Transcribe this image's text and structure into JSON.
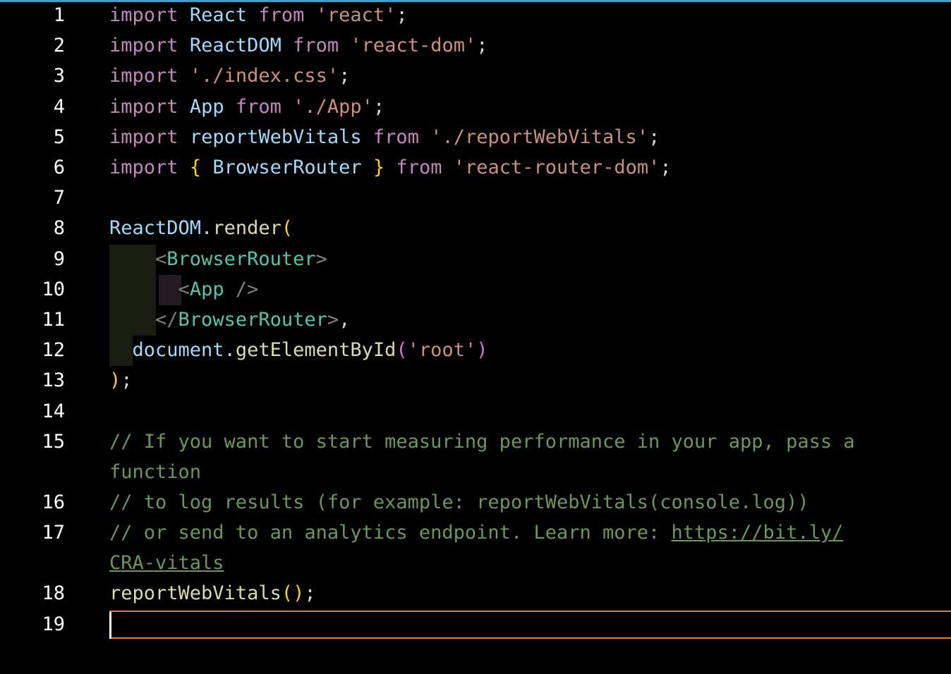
{
  "editor": {
    "language": "javascript",
    "active_line": "19",
    "lines": [
      {
        "n": "1",
        "tokens": [
          [
            "kw",
            "import"
          ],
          [
            "plain",
            " "
          ],
          [
            "var",
            "React"
          ],
          [
            "plain",
            " "
          ],
          [
            "kw",
            "from"
          ],
          [
            "plain",
            " "
          ],
          [
            "str",
            "'react'"
          ],
          [
            "plain",
            ";"
          ]
        ]
      },
      {
        "n": "2",
        "tokens": [
          [
            "kw",
            "import"
          ],
          [
            "plain",
            " "
          ],
          [
            "var",
            "ReactDOM"
          ],
          [
            "plain",
            " "
          ],
          [
            "kw",
            "from"
          ],
          [
            "plain",
            " "
          ],
          [
            "str",
            "'react-dom'"
          ],
          [
            "plain",
            ";"
          ]
        ]
      },
      {
        "n": "3",
        "tokens": [
          [
            "kw",
            "import"
          ],
          [
            "plain",
            " "
          ],
          [
            "str",
            "'./index.css'"
          ],
          [
            "plain",
            ";"
          ]
        ]
      },
      {
        "n": "4",
        "tokens": [
          [
            "kw",
            "import"
          ],
          [
            "plain",
            " "
          ],
          [
            "var",
            "App"
          ],
          [
            "plain",
            " "
          ],
          [
            "kw",
            "from"
          ],
          [
            "plain",
            " "
          ],
          [
            "str",
            "'./App'"
          ],
          [
            "plain",
            ";"
          ]
        ]
      },
      {
        "n": "5",
        "tokens": [
          [
            "kw",
            "import"
          ],
          [
            "plain",
            " "
          ],
          [
            "var",
            "reportWebVitals"
          ],
          [
            "plain",
            " "
          ],
          [
            "kw",
            "from"
          ],
          [
            "plain",
            " "
          ],
          [
            "str",
            "'./reportWebVitals'"
          ],
          [
            "plain",
            ";"
          ]
        ]
      },
      {
        "n": "6",
        "tokens": [
          [
            "kw",
            "import"
          ],
          [
            "plain",
            " "
          ],
          [
            "brace1",
            "{"
          ],
          [
            "plain",
            " "
          ],
          [
            "var",
            "BrowserRouter"
          ],
          [
            "plain",
            " "
          ],
          [
            "brace1",
            "}"
          ],
          [
            "plain",
            " "
          ],
          [
            "kw",
            "from"
          ],
          [
            "plain",
            " "
          ],
          [
            "str",
            "'react-router-dom'"
          ],
          [
            "plain",
            ";"
          ]
        ]
      },
      {
        "n": "7",
        "tokens": []
      },
      {
        "n": "8",
        "tokens": [
          [
            "var",
            "ReactDOM"
          ],
          [
            "plain",
            "."
          ],
          [
            "fn",
            "render"
          ],
          [
            "brace1",
            "("
          ]
        ]
      },
      {
        "n": "9",
        "tokens": [
          [
            "plain",
            "    "
          ],
          [
            "punc",
            "<"
          ],
          [
            "tag",
            "BrowserRouter"
          ],
          [
            "punc",
            ">"
          ]
        ]
      },
      {
        "n": "10",
        "tokens": [
          [
            "plain",
            "      "
          ],
          [
            "punc",
            "<"
          ],
          [
            "tag",
            "App"
          ],
          [
            "plain",
            " "
          ],
          [
            "punc",
            "/>"
          ]
        ]
      },
      {
        "n": "11",
        "tokens": [
          [
            "plain",
            "    "
          ],
          [
            "punc",
            "</"
          ],
          [
            "tag",
            "BrowserRouter"
          ],
          [
            "punc",
            ">"
          ],
          [
            "plain",
            ","
          ]
        ]
      },
      {
        "n": "12",
        "tokens": [
          [
            "plain",
            "  "
          ],
          [
            "var",
            "document"
          ],
          [
            "plain",
            "."
          ],
          [
            "fn",
            "getElementById"
          ],
          [
            "brace2",
            "("
          ],
          [
            "str",
            "'root'"
          ],
          [
            "brace2",
            ")"
          ]
        ]
      },
      {
        "n": "13",
        "tokens": [
          [
            "brace1",
            ")"
          ],
          [
            "plain",
            ";"
          ]
        ]
      },
      {
        "n": "14",
        "tokens": []
      },
      {
        "n": "15",
        "tokens": [
          [
            "cmt",
            "// If you want to start measuring performance in your app, pass a"
          ]
        ],
        "wrap": [
          [
            "cmt",
            "function"
          ]
        ]
      },
      {
        "n": "16",
        "tokens": [
          [
            "cmt",
            "// to log results (for example: reportWebVitals(console.log))"
          ]
        ]
      },
      {
        "n": "17",
        "tokens": [
          [
            "cmt",
            "// or send to an analytics endpoint. Learn more: "
          ],
          [
            "link",
            "https://bit.ly/"
          ]
        ],
        "wrap": [
          [
            "link",
            "CRA-vitals"
          ]
        ]
      },
      {
        "n": "18",
        "tokens": [
          [
            "fn",
            "reportWebVitals"
          ],
          [
            "brace1",
            "()"
          ],
          [
            "plain",
            ";"
          ]
        ]
      },
      {
        "n": "19",
        "tokens": []
      }
    ]
  }
}
